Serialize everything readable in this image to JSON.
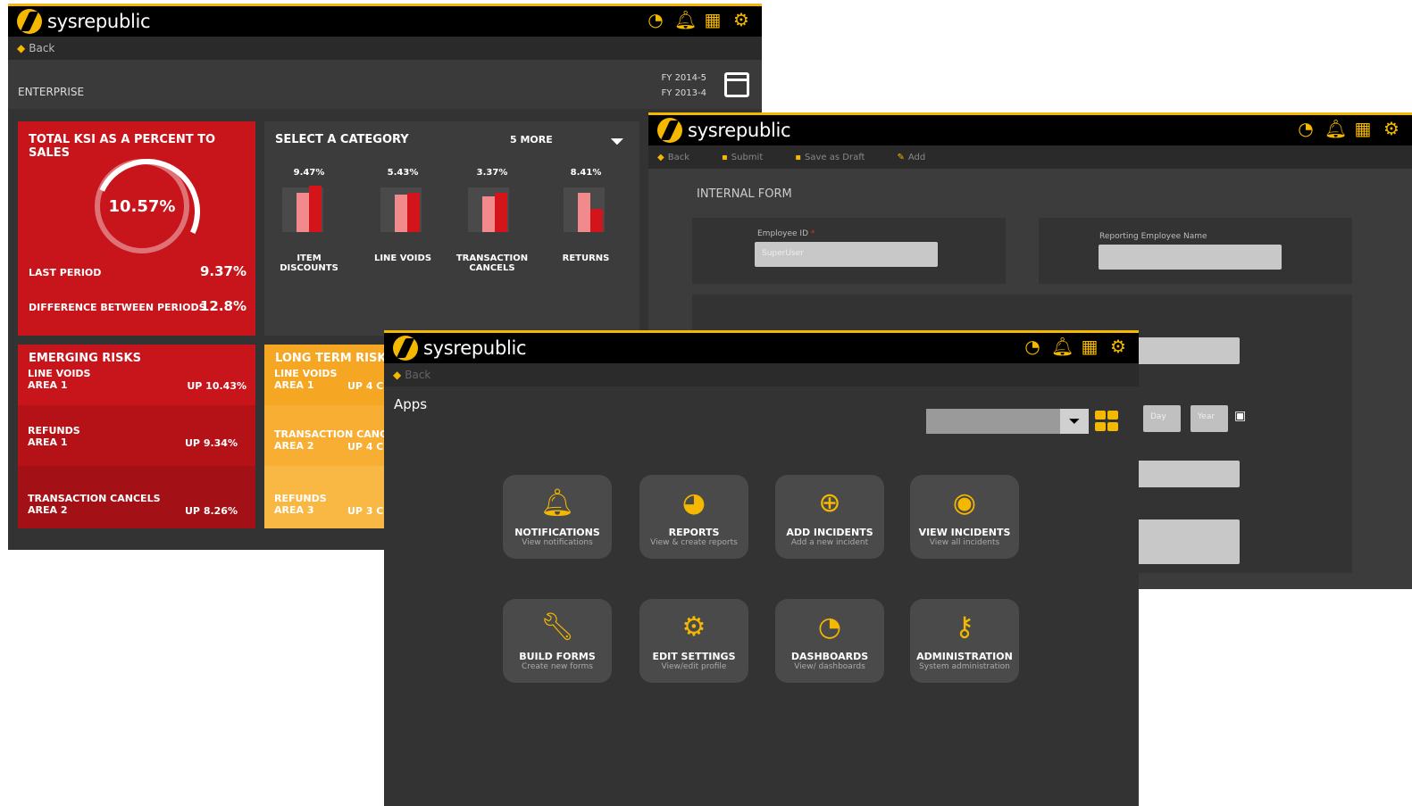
{
  "brand": "sysrepublic",
  "colors": {
    "accent": "#f5b800",
    "danger": "#c8141b",
    "warning": "#ffb32b"
  },
  "icons": [
    "dashboard-icon",
    "bell-icon",
    "grid-icon",
    "gear-icon"
  ],
  "dashboard": {
    "back_label": "Back",
    "section": "ENTERPRISE",
    "fy_current": "FY 2014-5",
    "fy_previous": "FY 2013-4",
    "ksi": {
      "title": "TOTAL KSI AS A PERCENT TO SALES",
      "value": "10.57%",
      "ring_fill_percent": 10.57,
      "last_period_label": "LAST PERIOD",
      "last_period_value": "9.37%",
      "diff_label": "DIFFERENCE BETWEEN PERIODS",
      "diff_value": "12.8%"
    },
    "category": {
      "title": "SELECT A CATEGORY",
      "more": "5 MORE",
      "items": [
        {
          "pct": "9.47%",
          "label1": "ITEM",
          "label2": "DISCOUNTS"
        },
        {
          "pct": "5.43%",
          "label1": "",
          "label2": "LINE VOIDS"
        },
        {
          "pct": "3.37%",
          "label1": "TRANSACTION",
          "label2": "CANCELS"
        },
        {
          "pct": "8.41%",
          "label1": "",
          "label2": "RETURNS"
        }
      ]
    },
    "emerging": {
      "title": "EMERGING RISKS",
      "rows": [
        {
          "name": "LINE VOIDS",
          "area": "AREA 1",
          "change": "UP 10.43%"
        },
        {
          "name": "REFUNDS",
          "area": "AREA 1",
          "change": "UP 9.34%"
        },
        {
          "name": "TRANSACTION CANCELS",
          "area": "AREA 2",
          "change": "UP 8.26%"
        }
      ]
    },
    "longterm": {
      "title": "LONG TERM RISKS",
      "rows": [
        {
          "name": "LINE VOIDS",
          "area": "AREA 1",
          "change": "UP 4 C"
        },
        {
          "name": "TRANSACTION CANC",
          "area": "AREA 2",
          "change": "UP 4 C"
        },
        {
          "name": "REFUNDS",
          "area": "AREA 3",
          "change": "UP 3 C"
        }
      ]
    }
  },
  "form": {
    "toolbar": {
      "back": "Back",
      "submit": "Submit",
      "draft": "Save as Draft",
      "add": "Add"
    },
    "title": "INTERNAL FORM",
    "employee_id_label": "Employee ID",
    "employee_id_value": "SuperUser",
    "reporting_label": "Reporting Employee Name",
    "reporting_value": "",
    "day_placeholder": "Day",
    "year_placeholder": "Year"
  },
  "apps": {
    "back_label": "Back",
    "title": "Apps",
    "search_value": "",
    "tiles": [
      {
        "title": "NOTIFICATIONS",
        "sub": "View notifications"
      },
      {
        "title": "REPORTS",
        "sub": "View & create reports"
      },
      {
        "title": "ADD INCIDENTS",
        "sub": "Add a new incident"
      },
      {
        "title": "VIEW INCIDENTS",
        "sub": "View all incidents"
      },
      {
        "title": "BUILD FORMS",
        "sub": "Create new forms"
      },
      {
        "title": "EDIT SETTINGS",
        "sub": "View/edit profile"
      },
      {
        "title": "DASHBOARDS",
        "sub": "View/ dashboards"
      },
      {
        "title": "ADMINISTRATION",
        "sub": "System administration"
      }
    ]
  }
}
